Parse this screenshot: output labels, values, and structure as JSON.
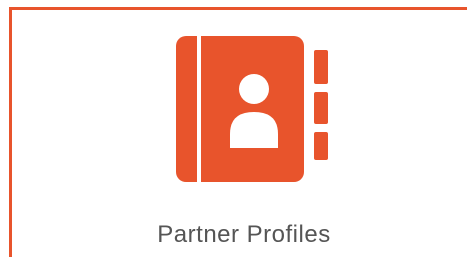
{
  "tile": {
    "label": "Partner Profiles",
    "icon": "address-book-icon",
    "accent_color": "#e8542c",
    "text_color": "#555555"
  }
}
